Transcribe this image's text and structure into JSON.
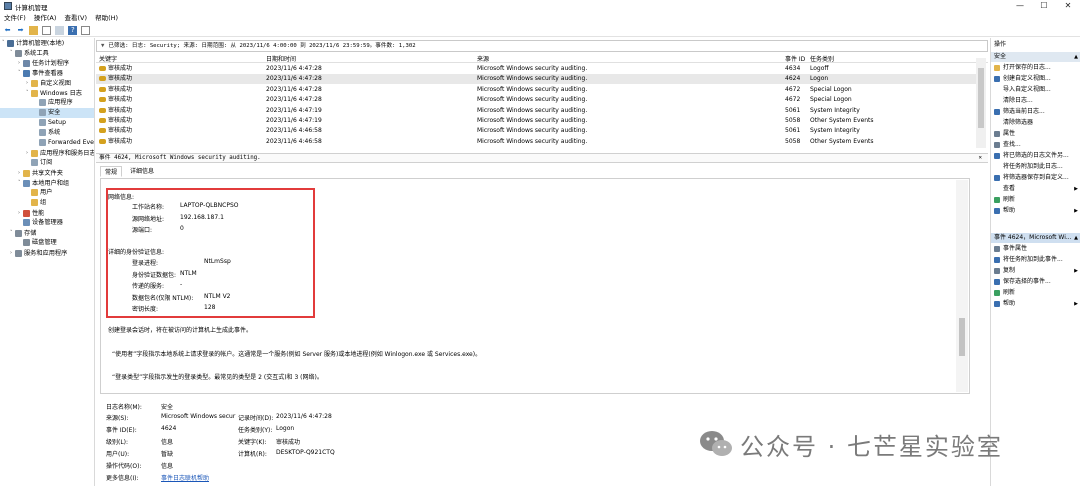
{
  "window": {
    "title": "计算机管理"
  },
  "menu": [
    "文件(F)",
    "操作(A)",
    "查看(V)",
    "帮助(H)"
  ],
  "tree": [
    {
      "label": "计算机管理(本地)",
      "indent": 0,
      "exp": "˅",
      "color": "#4a6d95"
    },
    {
      "label": "系统工具",
      "indent": 1,
      "exp": "˅",
      "color": "#7f8c99"
    },
    {
      "label": "任务计划程序",
      "indent": 2,
      "exp": "›",
      "color": "#6e88a8"
    },
    {
      "label": "事件查看器",
      "indent": 2,
      "exp": "˅",
      "color": "#4c7bb1"
    },
    {
      "label": "自定义视图",
      "indent": 3,
      "exp": "›",
      "color": "#e2b44a"
    },
    {
      "label": "Windows 日志",
      "indent": 3,
      "exp": "˅",
      "color": "#e2b44a"
    },
    {
      "label": "应用程序",
      "indent": 4,
      "exp": "",
      "color": "#8fa3b6"
    },
    {
      "label": "安全",
      "indent": 4,
      "exp": "",
      "color": "#8fa3b6",
      "selected": true
    },
    {
      "label": "Setup",
      "indent": 4,
      "exp": "",
      "color": "#8fa3b6"
    },
    {
      "label": "系统",
      "indent": 4,
      "exp": "",
      "color": "#8fa3b6"
    },
    {
      "label": "Forwarded Eve",
      "indent": 4,
      "exp": "",
      "color": "#8fa3b6"
    },
    {
      "label": "应用程序和服务日志",
      "indent": 3,
      "exp": "›",
      "color": "#e2b44a"
    },
    {
      "label": "订阅",
      "indent": 3,
      "exp": "",
      "color": "#8fa3b6"
    },
    {
      "label": "共享文件夹",
      "indent": 2,
      "exp": "›",
      "color": "#e2b44a"
    },
    {
      "label": "本地用户和组",
      "indent": 2,
      "exp": "˅",
      "color": "#6b8fb8"
    },
    {
      "label": "用户",
      "indent": 3,
      "exp": "",
      "color": "#e2b44a"
    },
    {
      "label": "组",
      "indent": 3,
      "exp": "",
      "color": "#e2b44a"
    },
    {
      "label": "性能",
      "indent": 2,
      "exp": "›",
      "color": "#d0503c"
    },
    {
      "label": "设备管理器",
      "indent": 2,
      "exp": "",
      "color": "#6b8fb8"
    },
    {
      "label": "存储",
      "indent": 1,
      "exp": "˅",
      "color": "#7f8c99"
    },
    {
      "label": "磁盘管理",
      "indent": 2,
      "exp": "",
      "color": "#7f8c99"
    },
    {
      "label": "服务和应用程序",
      "indent": 1,
      "exp": "›",
      "color": "#7f8c99"
    }
  ],
  "filter": {
    "text": "已筛选: 日志: Security; 来源: 日期范围: 从 2023/11/6 4:00:00 到 2023/11/6 23:59:59。事件数: 1,302"
  },
  "grid": {
    "headers": {
      "keyword": "关键字",
      "datetime": "日期和时间",
      "source": "来源",
      "eventid": "事件 ID",
      "category": "任务类别"
    },
    "rows": [
      {
        "keyword": "审核成功",
        "datetime": "2023/11/6 4:47:28",
        "source": "Microsoft Windows security auditing.",
        "eventid": "4634",
        "category": "Logoff"
      },
      {
        "keyword": "审核成功",
        "datetime": "2023/11/6 4:47:28",
        "source": "Microsoft Windows security auditing.",
        "eventid": "4624",
        "category": "Logon",
        "selected": true
      },
      {
        "keyword": "审核成功",
        "datetime": "2023/11/6 4:47:28",
        "source": "Microsoft Windows security auditing.",
        "eventid": "4672",
        "category": "Special Logon"
      },
      {
        "keyword": "审核成功",
        "datetime": "2023/11/6 4:47:28",
        "source": "Microsoft Windows security auditing.",
        "eventid": "4672",
        "category": "Special Logon"
      },
      {
        "keyword": "审核成功",
        "datetime": "2023/11/6 4:47:19",
        "source": "Microsoft Windows security auditing.",
        "eventid": "5061",
        "category": "System Integrity"
      },
      {
        "keyword": "审核成功",
        "datetime": "2023/11/6 4:47:19",
        "source": "Microsoft Windows security auditing.",
        "eventid": "5058",
        "category": "Other System Events"
      },
      {
        "keyword": "审核成功",
        "datetime": "2023/11/6 4:46:58",
        "source": "Microsoft Windows security auditing.",
        "eventid": "5061",
        "category": "System Integrity"
      },
      {
        "keyword": "审核成功",
        "datetime": "2023/11/6 4:46:58",
        "source": "Microsoft Windows security auditing.",
        "eventid": "5058",
        "category": "Other System Events"
      }
    ]
  },
  "detail": {
    "header": "事件 4624, Microsoft Windows security auditing.",
    "tabs": {
      "general": "常规",
      "details": "详细信息"
    },
    "network_title": "网络信息:",
    "network": [
      {
        "k": "工作站名称:",
        "v": "LAPTOP-QLBNCPSO"
      },
      {
        "k": "源网络地址:",
        "v": "192.168.187.1"
      },
      {
        "k": "源端口:",
        "v": "0"
      }
    ],
    "auth_title": "详细的身份验证信息:",
    "auth": [
      {
        "k": "登录进程:",
        "v": "NtLmSsp"
      },
      {
        "k": "身份验证数据包:",
        "v": "NTLM"
      },
      {
        "k": "传递的服务:",
        "v": "-"
      },
      {
        "k": "数据包名(仅限 NTLM):",
        "v": "NTLM V2"
      },
      {
        "k": "密钥长度:",
        "v": "128"
      }
    ],
    "p1": "创建登录会话时，将在被访问的计算机上生成此事件。",
    "p2": "“使用者”字段指示本地系统上请求登录的帐户。这通常是一个服务(例如 Server 服务)或本地进程(例如 Winlogon.exe 或 Services.exe)。",
    "p3": "“登录类型”字段指示发生的登录类型。最常见的类型是 2 (交互式)和 3 (网络)。"
  },
  "props": {
    "logname_label": "日志名称(M):",
    "logname": "安全",
    "source_label": "来源(S):",
    "source": "Microsoft Windows secur",
    "recorded_label": "记录时间(D):",
    "recorded": "2023/11/6 4:47:28",
    "eventid_label": "事件 ID(E):",
    "eventid": "4624",
    "taskcat_label": "任务类别(Y):",
    "taskcat": "Logon",
    "level_label": "级别(L):",
    "level": "信息",
    "keyword_label": "关键字(K):",
    "keyword": "审核成功",
    "user_label": "用户(U):",
    "user": "暂缺",
    "computer_label": "计算机(R):",
    "computer": "DESKTOP-Q921CTQ",
    "opcode_label": "操作代码(O):",
    "opcode": "信息",
    "more_label": "更多信息(I):",
    "more_link": "事件日志联机帮助"
  },
  "actions": {
    "title": "操作",
    "section1": "安全",
    "items1": [
      {
        "label": "打开保存的日志...",
        "color": "#e2b44a"
      },
      {
        "label": "创建自定义视图...",
        "color": "#3a6fb0"
      },
      {
        "label": "导入自定义视图...",
        "color": ""
      },
      {
        "label": "清除日志...",
        "color": ""
      },
      {
        "label": "筛选当前日志...",
        "color": "#3a6fb0"
      },
      {
        "label": "清除筛选器",
        "color": ""
      },
      {
        "label": "属性",
        "color": "#6b7d90"
      },
      {
        "label": "查找...",
        "color": "#6b7d90"
      },
      {
        "label": "将已筛选的日志文件另...",
        "color": "#3a6fb0"
      },
      {
        "label": "将任务附加到此日志...",
        "color": ""
      },
      {
        "label": "将筛选器保存到自定义...",
        "color": "#3a6fb0"
      },
      {
        "label": "查看",
        "color": "",
        "arrow": true
      },
      {
        "label": "刷新",
        "color": "#3aa060"
      },
      {
        "label": "帮助",
        "color": "#3a6fb0",
        "arrow": true
      }
    ],
    "section2": "事件 4624，Microsoft Wi...",
    "items2": [
      {
        "label": "事件属性",
        "color": "#6b7d90"
      },
      {
        "label": "将任务附加到此事件...",
        "color": "#3a6fb0"
      },
      {
        "label": "复制",
        "color": "#6b7d90",
        "arrow": true
      },
      {
        "label": "保存选择的事件...",
        "color": "#3a6fb0"
      },
      {
        "label": "刷新",
        "color": "#3aa060"
      },
      {
        "label": "帮助",
        "color": "#3a6fb0",
        "arrow": true
      }
    ]
  },
  "watermark": {
    "text": "公众号 · 七芒星实验室"
  }
}
